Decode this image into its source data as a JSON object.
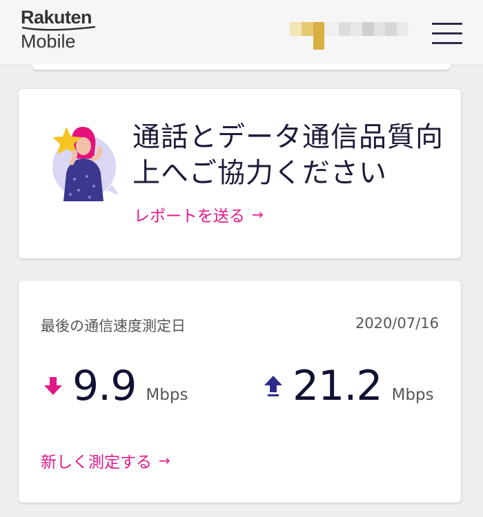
{
  "header": {
    "logo_top": "Rakuten",
    "logo_bottom": "Mobile",
    "menu_icon": "hamburger-menu-icon",
    "account_blurred": true
  },
  "survey_card": {
    "title": "通話とデータ通信品質向上へご協力ください",
    "link_label": "レポートを送る",
    "link_icon": "arrow-right-icon",
    "illustration": "woman-holding-star-illustration"
  },
  "speed_card": {
    "label": "最後の通信速度測定日",
    "date": "2020/07/16",
    "download": {
      "icon": "download-arrow-icon",
      "value": "9.9",
      "unit": "Mbps"
    },
    "upload": {
      "icon": "upload-arrow-icon",
      "value": "21.2",
      "unit": "Mbps"
    },
    "retest_label": "新しく測定する",
    "retest_icon": "arrow-right-icon"
  },
  "colors": {
    "accent": "#e0198a",
    "navy": "#2d2a8c",
    "text": "#1c1c3a",
    "muted": "#555555",
    "background": "#efefef"
  }
}
